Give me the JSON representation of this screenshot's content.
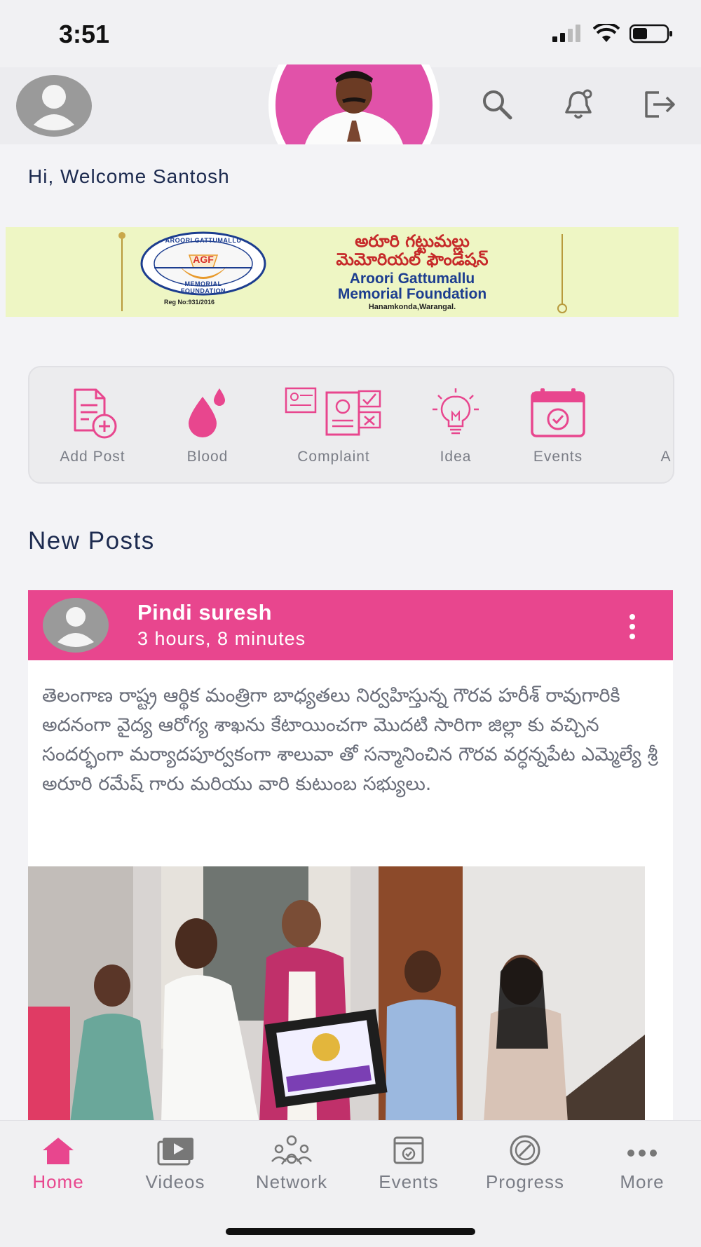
{
  "status_bar": {
    "time": "3:51"
  },
  "header": {
    "avatar_icon": "user-avatar-icon",
    "search_icon": "search-icon",
    "notification_icon": "bell-icon",
    "logout_icon": "logout-icon"
  },
  "welcome_text": "Hi, Welcome Santosh",
  "banner": {
    "telugu_line1": "అరూరి గట్టుమల్లు",
    "telugu_line2": "మెమోరియల్ ఫౌండేషన్",
    "name_line1": "Aroori Gattumallu",
    "name_line2": "Memorial Foundation",
    "location": "Hanamkonda,Warangal.",
    "reg_no": "Reg No:931/2016",
    "logo_top": "AROORI GATTUMALLU",
    "logo_bottom": "MEMORIAL FOUNDATION",
    "logo_mark": "AGF"
  },
  "quick_actions": [
    {
      "label": "Add Post",
      "icon": "add-post-icon"
    },
    {
      "label": "Blood",
      "icon": "blood-drop-icon"
    },
    {
      "label": "Complaint",
      "icon": "complaint-icon"
    },
    {
      "label": "Idea",
      "icon": "lightbulb-icon"
    },
    {
      "label": "Events",
      "icon": "calendar-check-icon"
    },
    {
      "label": "A"
    }
  ],
  "section_title": "New Posts",
  "post": {
    "author": "Pindi suresh",
    "time": "3 hours, 8 minutes",
    "text": "తెలంగాణ రాష్ట్ర ఆర్థిక మంత్రిగా బాధ్యతలు నిర్వహిస్తున్న గౌరవ హరీశ్ రావుగారికి అదనంగా వైద్య ఆరోగ్య శాఖను కేటాయించగా మొదటి సారిగా జిల్లా కు వచ్చిన సందర్భంగా మర్యాదపూర్వకంగా శాలువా తో సన్మానించిన గౌరవ వర్ధన్నపేట ఎమ్మెల్యే శ్రీ అరూరి రమేష్ గారు మరియు వారి కుటుంబ సభ్యులు.",
    "menu_icon": "kebab-menu-icon"
  },
  "tabs": [
    {
      "label": "Home",
      "icon": "home-icon",
      "active": true
    },
    {
      "label": "Videos",
      "icon": "video-icon",
      "active": false
    },
    {
      "label": "Network",
      "icon": "network-icon",
      "active": false
    },
    {
      "label": "Events",
      "icon": "calendar-icon",
      "active": false
    },
    {
      "label": "Progress",
      "icon": "progress-icon",
      "active": false
    },
    {
      "label": "More",
      "icon": "more-dots-icon",
      "active": false
    }
  ],
  "colors": {
    "accent": "#e8468e",
    "text_dark": "#1c2a4f",
    "text_muted": "#7a7d86",
    "banner_bg": "#eef6c4"
  }
}
